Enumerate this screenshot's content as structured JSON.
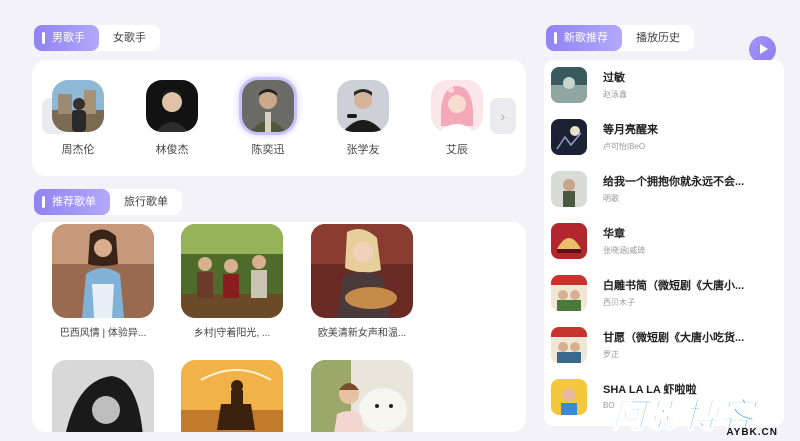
{
  "singer_tabs": [
    {
      "label": "男歌手",
      "active": true
    },
    {
      "label": "女歌手",
      "active": false
    }
  ],
  "singers": [
    {
      "name": "周杰伦",
      "selected": false
    },
    {
      "name": "林俊杰",
      "selected": false
    },
    {
      "name": "陈奕迅",
      "selected": true
    },
    {
      "name": "张学友",
      "selected": false
    },
    {
      "name": "艾辰",
      "selected": false
    }
  ],
  "playlist_tabs": [
    {
      "label": "推荐歌单",
      "active": true
    },
    {
      "label": "旅行歌单",
      "active": false
    }
  ],
  "playlists": [
    {
      "caption": "巴西风情 | 体验异..."
    },
    {
      "caption": "乡村|守着阳光, ..."
    },
    {
      "caption": "欧美清新女声和温..."
    },
    {
      "caption": ""
    },
    {
      "caption": ""
    },
    {
      "caption": ""
    }
  ],
  "song_tabs": [
    {
      "label": "新歌推荐",
      "active": true
    },
    {
      "label": "播放历史",
      "active": false
    }
  ],
  "songs": [
    {
      "title": "过敏",
      "artist": "赵泳鑫"
    },
    {
      "title": "等月亮醒来",
      "artist": "卢可怡|BeO"
    },
    {
      "title": "给我一个拥抱你就永远不会...",
      "artist": "明歌"
    },
    {
      "title": "华章",
      "artist": "张晓涵|威琦"
    },
    {
      "title": "白雕书简（微短剧《大唐小...",
      "artist": "西贝木子"
    },
    {
      "title": "甘愿（微短剧《大唐小吃货...",
      "artist": "罗正"
    },
    {
      "title": "SHA LA LA 虾啦啦",
      "artist": "BO"
    }
  ],
  "watermark": {
    "text": "阿影博客",
    "sub": "AYBK.CN"
  },
  "colors": {
    "accent": "#9a8df5",
    "background": "#f3f2f8"
  }
}
